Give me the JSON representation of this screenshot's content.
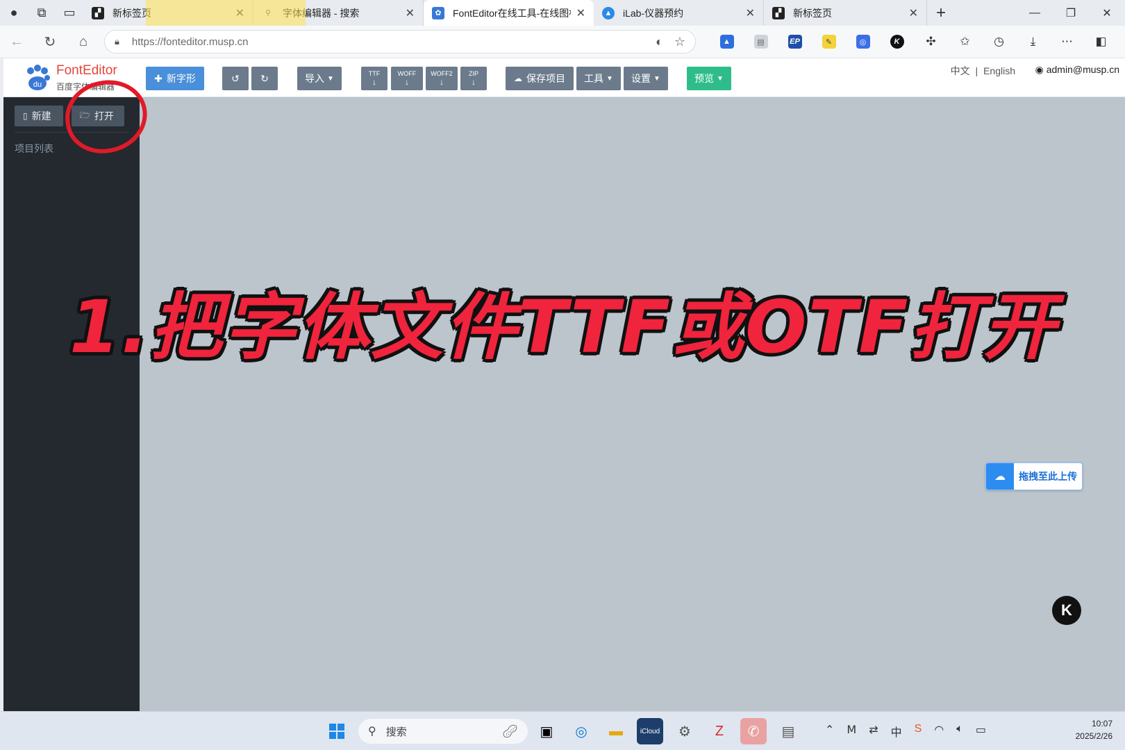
{
  "browser": {
    "tabs": [
      {
        "title": "新标签页",
        "active": false
      },
      {
        "title": "字体编辑器 - 搜索",
        "active": false
      },
      {
        "title": "FontEditor在线工具-在线图标",
        "active": true
      },
      {
        "title": "iLab-仪器预约",
        "active": false
      },
      {
        "title": "新标签页",
        "active": false
      }
    ],
    "url": "https://fonteditor.musp.cn"
  },
  "app": {
    "logo_title": "FontEditor",
    "logo_subtitle": "百度字体编辑器",
    "toolbar": {
      "new_glyph": "新字形",
      "import": "导入",
      "ttf": "TTF",
      "woff": "WOFF",
      "woff2": "WOFF2",
      "zip": "ZIP",
      "save_project": "保存项目",
      "tools": "工具",
      "settings": "设置",
      "preview": "预览"
    },
    "lang_zh": "中文",
    "lang_sep": "|",
    "lang_en": "English",
    "user": "admin@musp.cn",
    "sidebar": {
      "new_btn": "新建",
      "open_btn": "打开",
      "project_list": "项目列表"
    },
    "upload_widget": "拖拽至此上传",
    "float_badge": "K"
  },
  "overlay": {
    "headline": "1.把字体文件TTF或OTF打开"
  },
  "taskbar": {
    "search_placeholder": "搜索",
    "time": "10:07",
    "date": "2025/2/26",
    "ime": "中",
    "cloud_label": "iCloud"
  },
  "colors": {
    "accent_blue": "#4a8fd9",
    "preview_green": "#2ebd8a",
    "sidebar_bg": "#23292f",
    "workspace_bg": "#bcc4cc",
    "headline_red": "#f0243c",
    "annotation_red": "#e11a28"
  }
}
